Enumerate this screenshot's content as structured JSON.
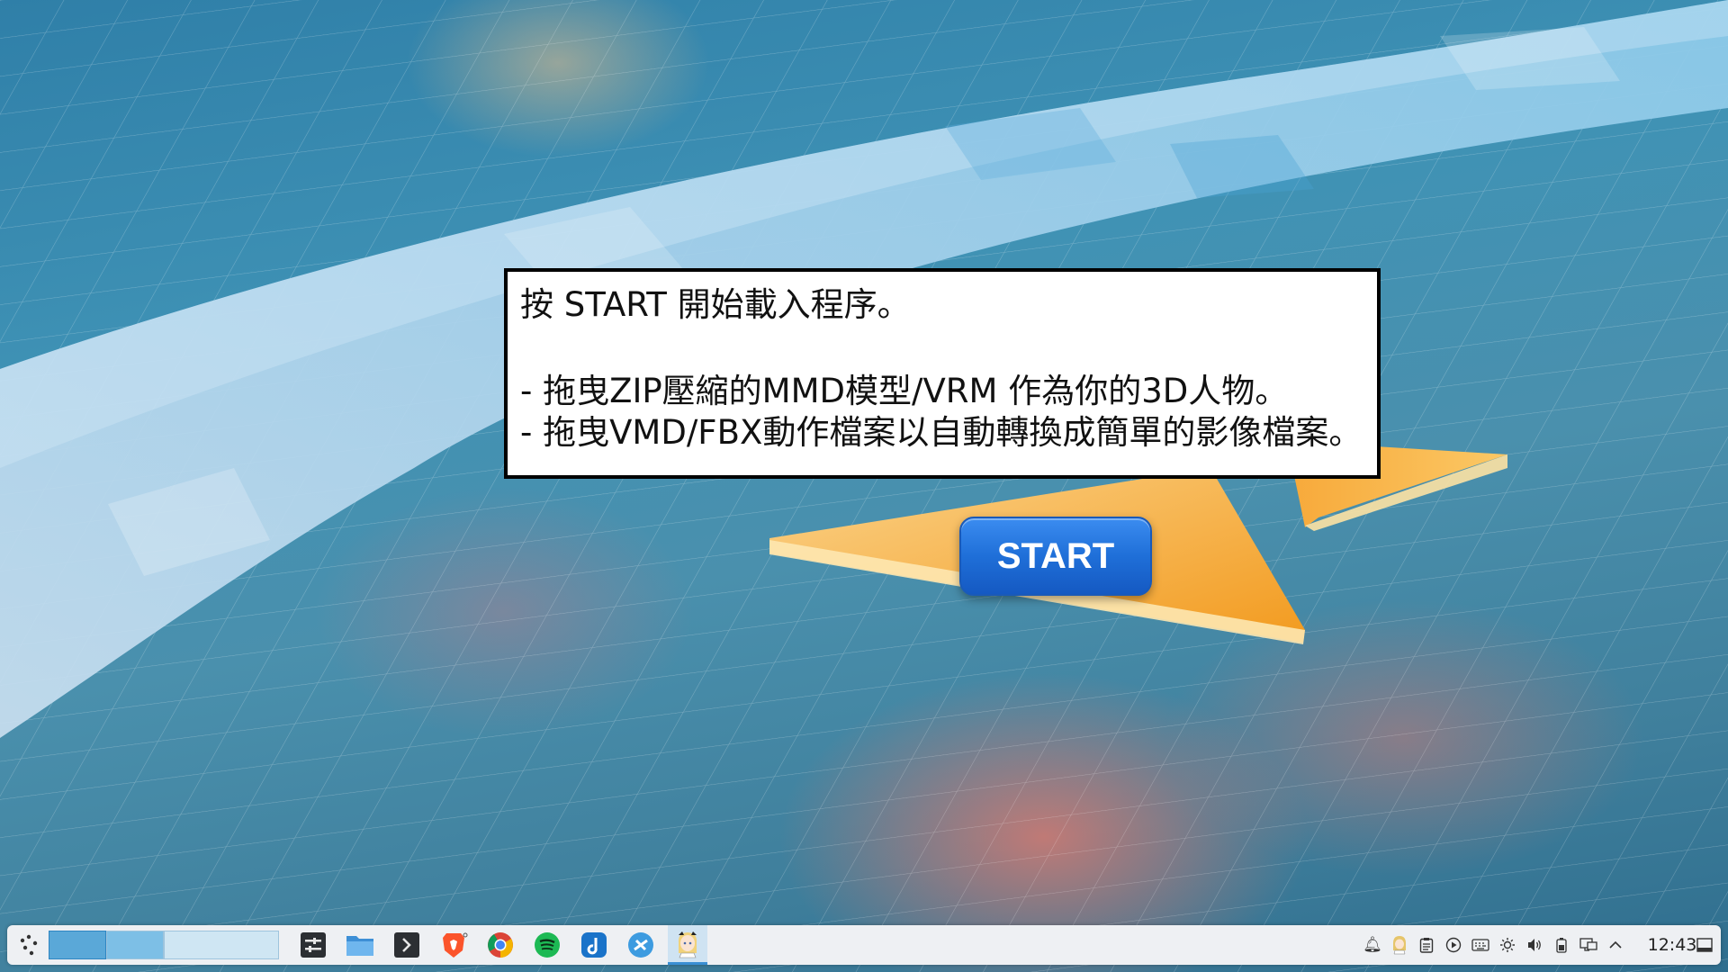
{
  "dialog": {
    "line1": "按 START 開始載入程序。",
    "line2": "- 拖曳ZIP壓縮的MMD模型/VRM 作為你的3D人物。",
    "line3": "- 拖曳VMD/FBX動作檔案以自動轉換成簡單的影像檔案。"
  },
  "start_button": {
    "label": "START"
  },
  "taskbar": {
    "apps": [
      "system-settings-icon",
      "file-manager-icon",
      "terminal-icon",
      "brave-browser-icon",
      "chrome-browser-icon",
      "spotify-icon",
      "music-app-icon",
      "discover-app-icon",
      "mmd-character-app-icon"
    ],
    "tray": [
      "notification-bell-icon",
      "character-tray-icon",
      "clipboard-icon",
      "media-player-icon",
      "keyboard-icon",
      "brightness-icon",
      "volume-icon",
      "battery-icon",
      "network-icon",
      "expand-tray-icon"
    ],
    "clock": "12:43"
  },
  "colors": {
    "start_button": "#1f6fd8",
    "taskbar_bg": "#eef0f3",
    "dialog_border": "#000000",
    "triangle_orange": "#f5a623"
  }
}
